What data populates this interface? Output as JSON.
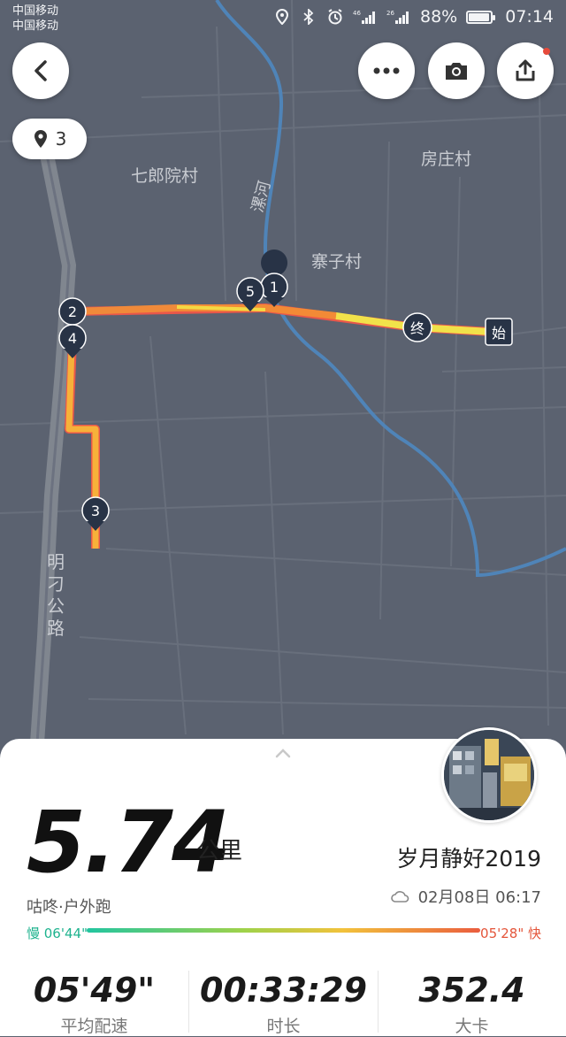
{
  "status_bar": {
    "carrier1": "中国移动",
    "carrier2": "中国移动",
    "signal1": "46",
    "signal2": "26",
    "battery_percent": "88%",
    "battery_level": 0.88,
    "time": "07:14"
  },
  "top_bar": {
    "back_icon": "chevron-left-icon",
    "more_icon": "more-dots-icon",
    "camera_icon": "camera-icon",
    "share_icon": "share-icon",
    "share_has_badge": true
  },
  "marker_pill": {
    "icon": "map-pin-icon",
    "count": "3"
  },
  "map": {
    "colors": {
      "land": "#5b6270",
      "road": "#7a808c",
      "river": "#4f84b8"
    },
    "labels": [
      "七郎院村",
      "房庄村",
      "寨子村",
      "漯河",
      "明刁公路"
    ],
    "markers": [
      "1",
      "2",
      "3",
      "4",
      "5"
    ],
    "end_label": "终",
    "start_label": "始"
  },
  "summary": {
    "distance": "5.74",
    "distance_unit": "公里",
    "sport": "咕咚·户外跑",
    "username": "岁月静好2019",
    "weather_icon": "cloud-icon",
    "datetime": "02月08日 06:17",
    "pace_slow": "慢 06'44\"",
    "pace_fast": "05'28\" 快",
    "colors": {
      "slow": "#1eb38e",
      "fast": "#e4553a"
    }
  },
  "stats": [
    {
      "value": "05'49\"",
      "label": "平均配速"
    },
    {
      "value": "00:33:29",
      "label": "时长"
    },
    {
      "value": "352.4",
      "label": "大卡"
    }
  ]
}
